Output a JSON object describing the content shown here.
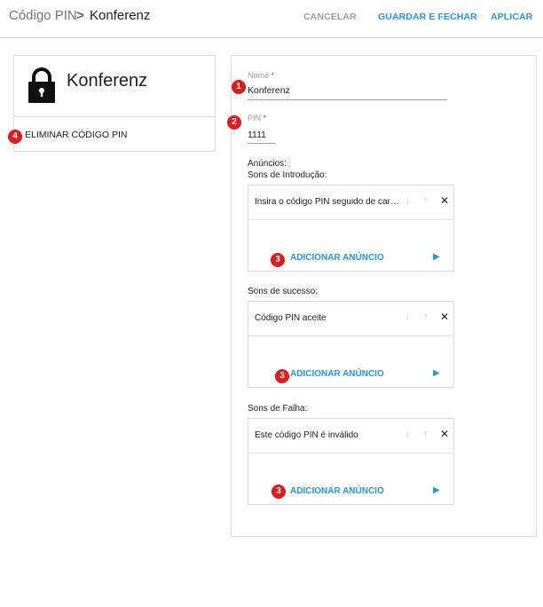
{
  "header": {
    "breadcrumb_parent": "Código PIN",
    "breadcrumb_separator": ">",
    "breadcrumb_current": "Konferenz",
    "cancel_label": "CANCELAR",
    "save_close_label": "GUARDAR E FECHAR",
    "apply_label": "APLICAR"
  },
  "left_card": {
    "icon": "lock-icon",
    "title": "Konferenz",
    "delete_label": "ELIMINAR CÓDIGO PIN"
  },
  "form": {
    "name_label": "Nome",
    "name_value": "Konferenz",
    "pin_label": "PIN",
    "pin_value": "1111",
    "required_mark": "*",
    "announcements_label": "Anúncios:",
    "groups": [
      {
        "label": "Sons de Introdução:",
        "item": "Insira o código PIN seguido de cardinal",
        "add_label": "ADICIONAR ANÚNCIO"
      },
      {
        "label": "Sons de sucesso:",
        "item": "Código PIN aceite",
        "add_label": "ADICIONAR ANÚNCIO"
      },
      {
        "label": "Sons de Falha:",
        "item": "Este código PIN é inválido",
        "add_label": "ADICIONAR ANÚNCIO"
      }
    ]
  },
  "markers": [
    "1",
    "2",
    "3",
    "3",
    "3",
    "4"
  ],
  "colors": {
    "accent": "#2196f3",
    "marker": "#e01b1b",
    "required": "#e53935"
  }
}
